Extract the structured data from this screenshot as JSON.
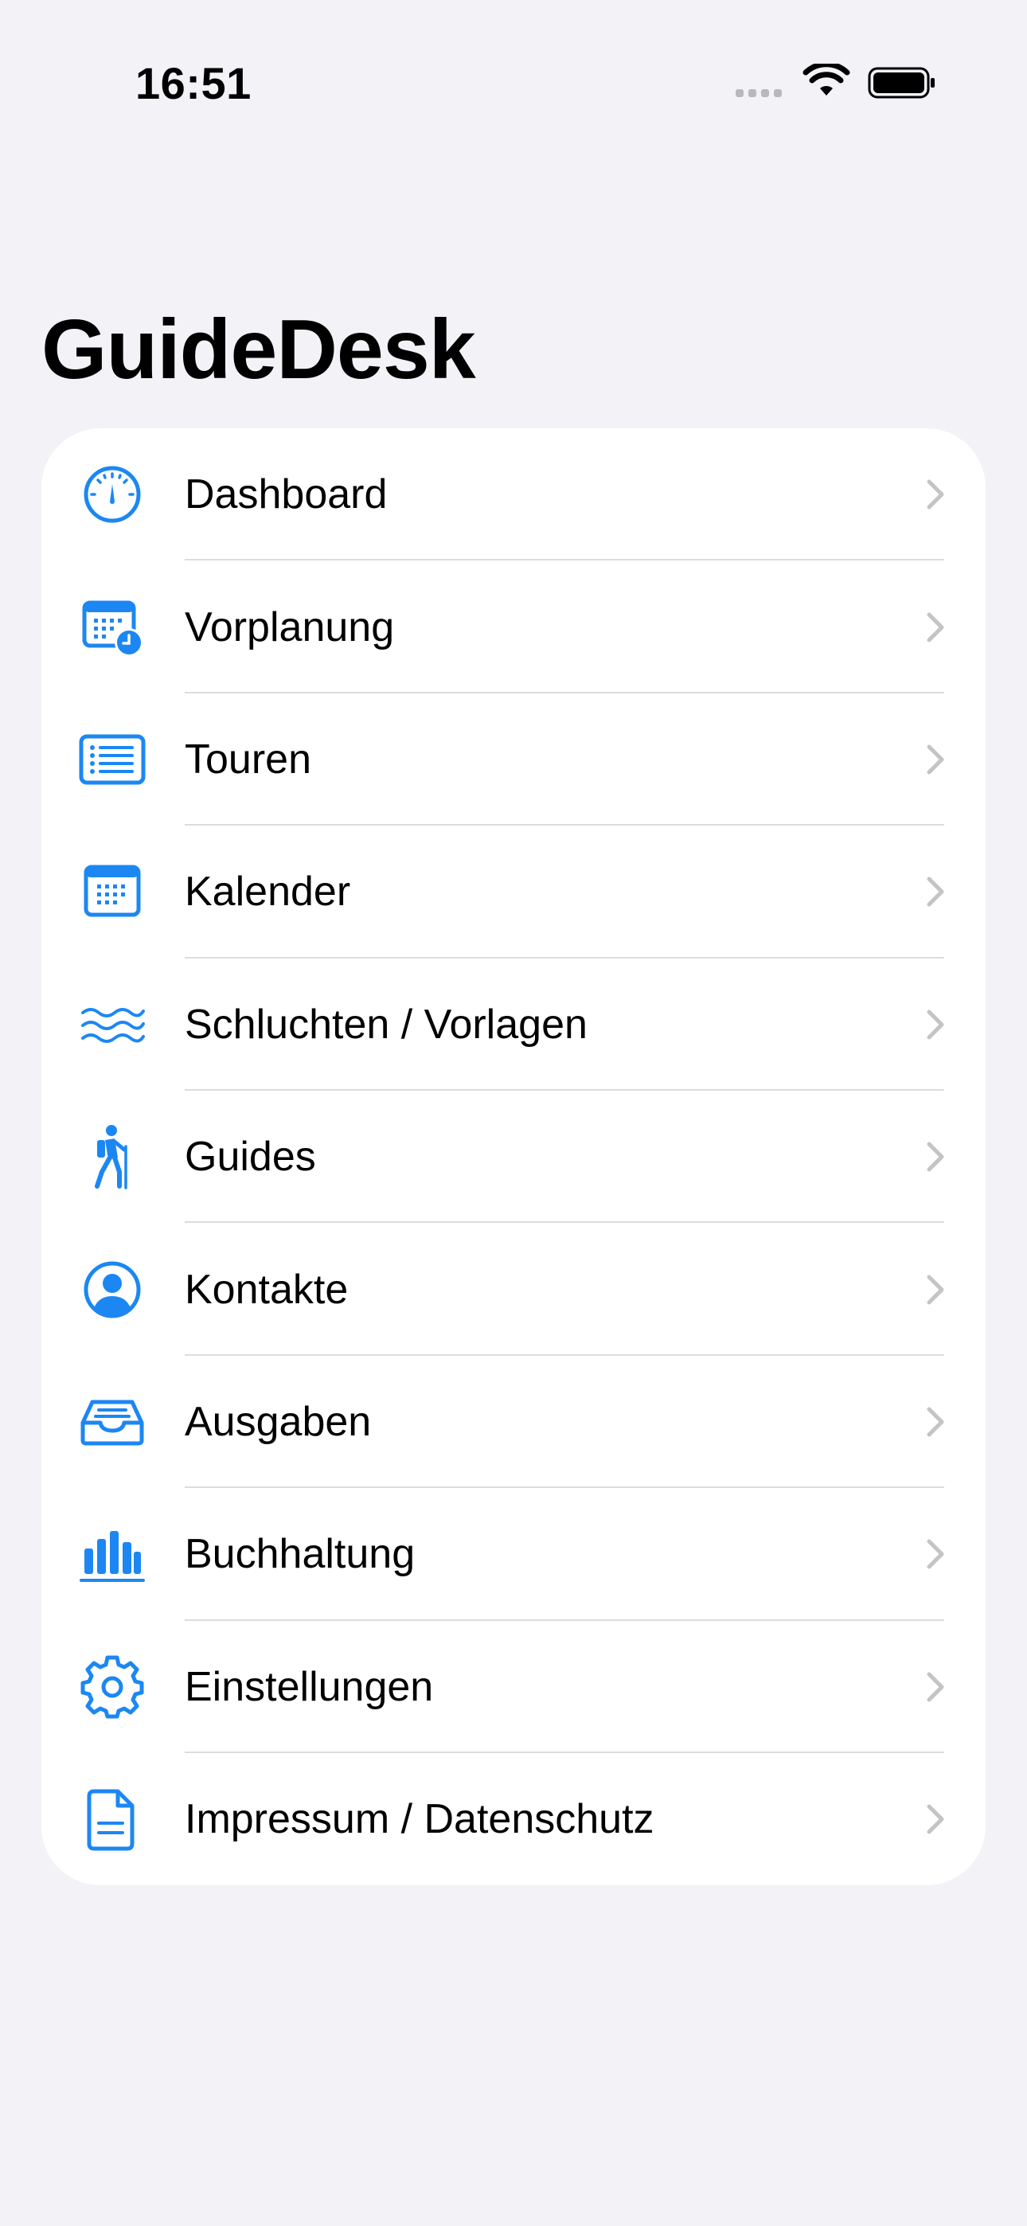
{
  "status_bar": {
    "time": "16:51"
  },
  "title": "GuideDesk",
  "accent_color": "#1c87f2",
  "menu": [
    {
      "label": "Dashboard",
      "icon": "gauge-icon"
    },
    {
      "label": "Vorplanung",
      "icon": "calendar-clock-icon"
    },
    {
      "label": "Touren",
      "icon": "list-icon"
    },
    {
      "label": "Kalender",
      "icon": "calendar-icon"
    },
    {
      "label": "Schluchten / Vorlagen",
      "icon": "water-waves-icon"
    },
    {
      "label": "Guides",
      "icon": "hiker-icon"
    },
    {
      "label": "Kontakte",
      "icon": "person-circle-icon"
    },
    {
      "label": "Ausgaben",
      "icon": "tray-icon"
    },
    {
      "label": "Buchhaltung",
      "icon": "bar-chart-icon"
    },
    {
      "label": "Einstellungen",
      "icon": "gear-icon"
    },
    {
      "label": "Impressum / Datenschutz",
      "icon": "document-icon"
    }
  ]
}
